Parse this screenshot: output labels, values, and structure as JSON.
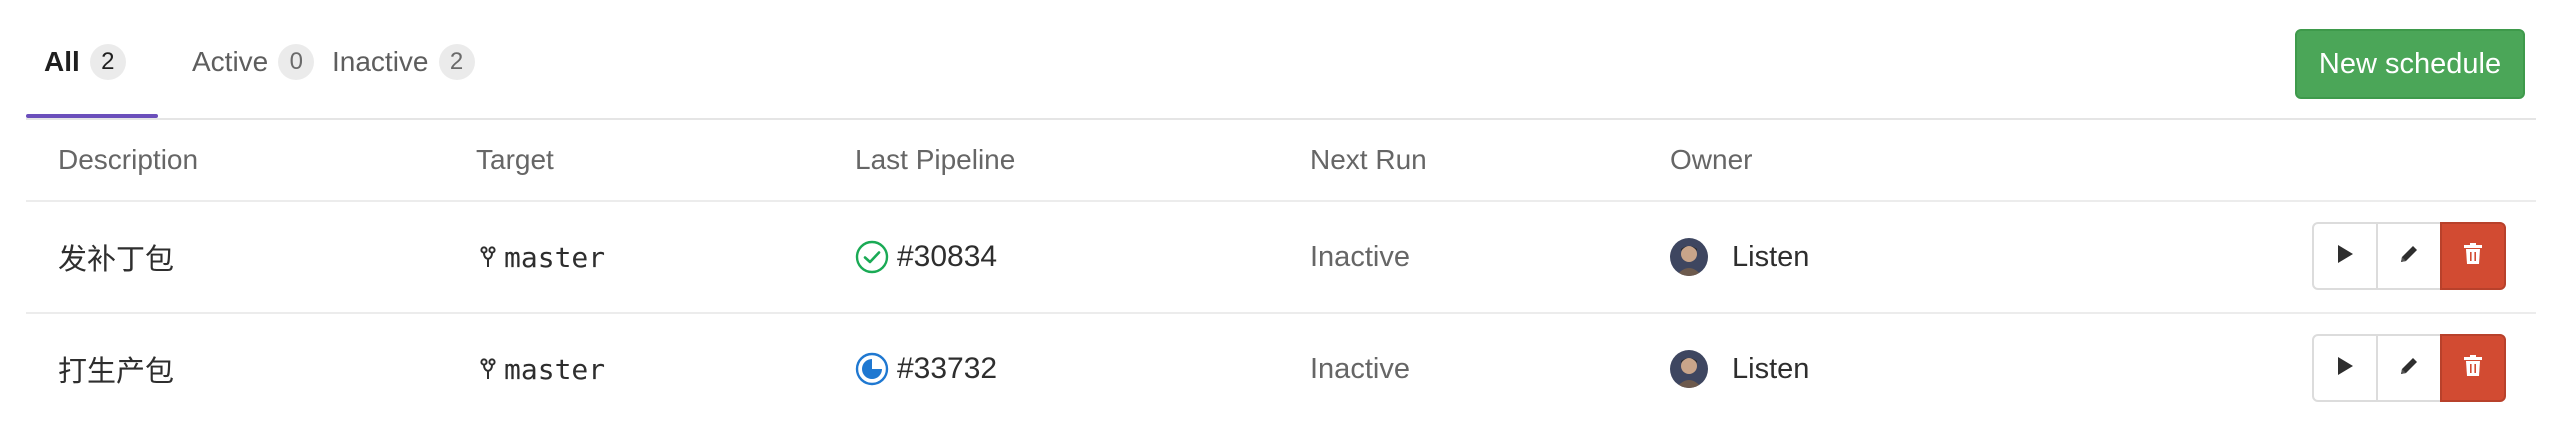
{
  "tabs": [
    {
      "label": "All",
      "count": "2"
    },
    {
      "label": "Active",
      "count": "0"
    },
    {
      "label": "Inactive",
      "count": "2"
    }
  ],
  "new_schedule_label": "New schedule",
  "table": {
    "headers": {
      "description": "Description",
      "target": "Target",
      "last_pipeline": "Last Pipeline",
      "next_run": "Next Run",
      "owner": "Owner"
    },
    "rows": [
      {
        "description": "发补丁包",
        "target": "master",
        "pipeline": "#30834",
        "pipeline_status": "passed",
        "next_run": "Inactive",
        "owner": "Listen"
      },
      {
        "description": "打生产包",
        "target": "master",
        "pipeline": "#33732",
        "pipeline_status": "running",
        "next_run": "Inactive",
        "owner": "Listen"
      }
    ]
  },
  "icons": {
    "branch": "git-branch-icon",
    "passed": "check-circle-icon",
    "running": "running-status-icon",
    "play": "play-icon",
    "edit": "pencil-icon",
    "delete": "trash-icon"
  },
  "colors": {
    "tab_indicator": "#6b4fbb",
    "new_button": "#4ba658",
    "delete_button": "#d24b32",
    "status_passed": "#1aaa55",
    "status_running": "#1f78d1"
  }
}
